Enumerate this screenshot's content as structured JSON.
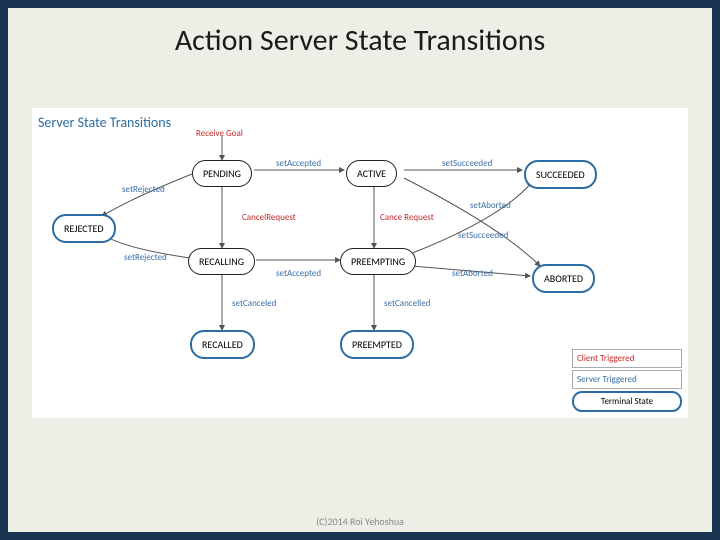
{
  "title": "Action Server State Transitions",
  "diagram_title": "Server State Transitions",
  "footer": "(C)2014 Roi Yehoshua",
  "states": {
    "pending": "PENDING",
    "active": "ACTIVE",
    "succeeded": "SUCCEEDED",
    "rejected": "REJECTED",
    "recalling": "RECALLING",
    "preempting": "PREEMPTING",
    "aborted": "ABORTED",
    "recalled": "RECALLED",
    "preempted": "PREEMPTED"
  },
  "labels": {
    "receive_goal": "Receive Goal",
    "set_accepted": "setAccepted",
    "set_succeeded": "setSucceeded",
    "set_rejected": "setRejected",
    "cancel_request": "CancelRequest",
    "cance_request": "Cance Request",
    "set_aborted": "setAborted",
    "set_succeeded2": "setSucceeded",
    "set_rejected2": "setRejected",
    "set_accepted2": "setAccepted",
    "set_aborted2": "setAborted",
    "set_canceled": "setCanceled",
    "set_cancelled": "setCancelled"
  },
  "legend": {
    "client": "Client Triggered",
    "server": "Server Triggered",
    "terminal": "Terminal State"
  }
}
